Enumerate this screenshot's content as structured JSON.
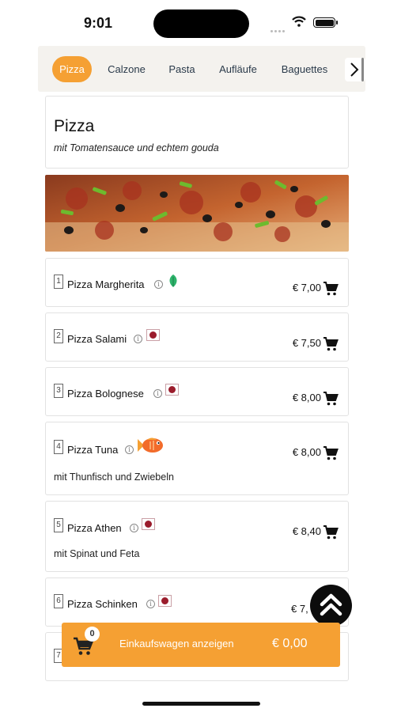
{
  "status": {
    "time": "9:01"
  },
  "categories": [
    "Pizza",
    "Calzone",
    "Pasta",
    "Aufläufe",
    "Baguettes"
  ],
  "section": {
    "title": "Pizza",
    "subtitle": "mit Tomatensauce und echtem gouda"
  },
  "items": [
    {
      "number": "1",
      "name": "Pizza Margherita",
      "tag_icon": "vegetarian-leaf-icon",
      "price": "€ 7,00",
      "description": ""
    },
    {
      "number": "2",
      "name": "Pizza Salami",
      "tag_icon": "meat-icon",
      "price": "€ 7,50",
      "description": ""
    },
    {
      "number": "3",
      "name": "Pizza Bolognese",
      "tag_icon": "meat-icon",
      "price": "€ 8,00",
      "description": ""
    },
    {
      "number": "4",
      "name": "Pizza Tuna",
      "tag_icon": "fish-icon",
      "price": "€ 8,00",
      "description": "mit Thunfisch und Zwiebeln"
    },
    {
      "number": "5",
      "name": "Pizza Athen",
      "tag_icon": "meat-icon",
      "price": "€ 8,40",
      "description": "mit Spinat und Feta"
    },
    {
      "number": "6",
      "name": "Pizza Schinken",
      "tag_icon": "meat-icon",
      "price": "€ 7,",
      "description": ""
    },
    {
      "number": "7",
      "name": "",
      "tag_icon": "",
      "price": "",
      "description": ""
    }
  ],
  "cart": {
    "count": "0",
    "label": "Einkaufswagen anzeigen",
    "total": "€ 0,00"
  },
  "colors": {
    "accent": "#f5a033",
    "leaf": "#2db36b",
    "meat": "#9b1c2c",
    "fish": "#f26b2a"
  }
}
